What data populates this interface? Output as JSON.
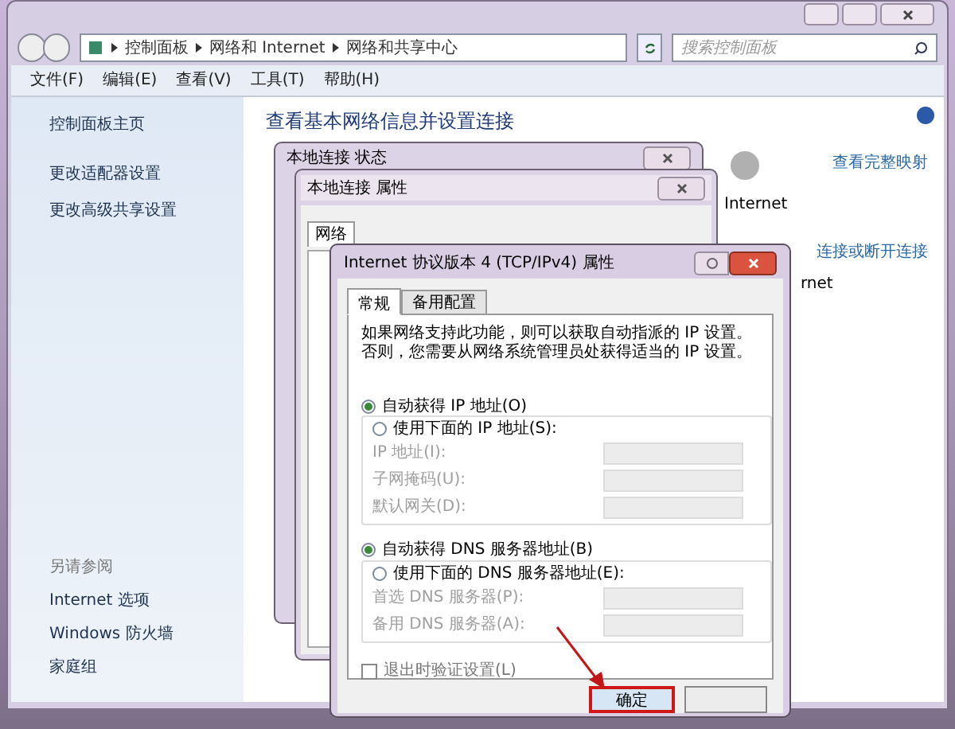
{
  "breadcrumb": [
    "控制面板",
    "网络和 Internet",
    "网络和共享中心"
  ],
  "search": {
    "placeholder": "搜索控制面板"
  },
  "menu": [
    "文件(F)",
    "编辑(E)",
    "查看(V)",
    "工具(T)",
    "帮助(H)"
  ],
  "sidebar": {
    "items": [
      "控制面板主页",
      "更改适配器设置",
      "更改高级共享设置"
    ],
    "see_also_title": "另请参阅",
    "see_also": [
      "Internet 选项",
      "Windows 防火墙",
      "家庭组"
    ]
  },
  "main": {
    "heading": "查看基本网络信息并设置连接",
    "internet_label": "Internet",
    "view_map_link": "查看完整映射",
    "connect_link": "连接或断开连接",
    "partial_label": "rnet"
  },
  "status_dialog": {
    "title": "本地连接 状态"
  },
  "properties_dialog": {
    "title": "本地连接 属性",
    "tab": "网络"
  },
  "ipv4_dialog": {
    "title": "Internet 协议版本 4 (TCP/IPv4) 属性",
    "tabs": [
      {
        "label": "常规",
        "selected": true
      },
      {
        "label": "备用配置",
        "selected": false
      }
    ],
    "intro": "如果网络支持此功能，则可以获取自动指派的 IP 设置。否则，您需要从网络系统管理员处获得适当的 IP 设置。",
    "ip_radios": [
      {
        "label": "自动获得 IP 地址(O)",
        "selected": true
      },
      {
        "label": "使用下面的 IP 地址(S):",
        "selected": false
      }
    ],
    "ip_fields": [
      {
        "label": "IP 地址(I):",
        "disabled": true
      },
      {
        "label": "子网掩码(U):",
        "disabled": true
      },
      {
        "label": "默认网关(D):",
        "disabled": true
      }
    ],
    "dns_radios": [
      {
        "label": "自动获得 DNS 服务器地址(B)",
        "selected": true
      },
      {
        "label": "使用下面的 DNS 服务器地址(E):",
        "selected": false
      }
    ],
    "dns_fields": [
      {
        "label": "首选 DNS 服务器(P):",
        "disabled": true
      },
      {
        "label": "备用 DNS 服务器(A):",
        "disabled": true
      }
    ],
    "validate": {
      "label": "退出时验证设置(L)",
      "checked": false
    },
    "ok_button": "确定"
  }
}
